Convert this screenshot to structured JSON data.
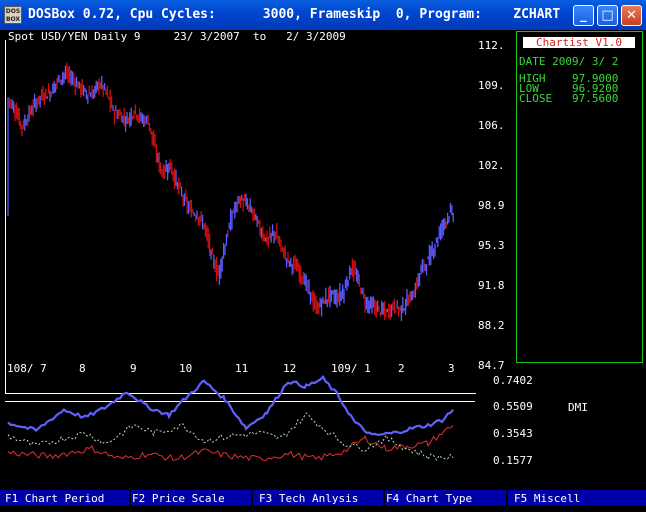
{
  "window": {
    "icon_text": "DOS BOX",
    "title": "DOSBox 0.72, Cpu Cycles:      3000, Frameskip  0, Program:    ZCHART",
    "buttons": {
      "minimize": "_",
      "maximize": "□",
      "close": "✕"
    }
  },
  "chart": {
    "header": "Spot USD/YEN Daily 9     23/ 3/2007  to   2/ 3/2009",
    "y_ticks": [
      "112.",
      "109.",
      "106.",
      "102.",
      "98.9",
      "95.3",
      "91.8",
      "88.2",
      "84.7"
    ],
    "x_ticks": [
      "108/ 7",
      "8",
      "9",
      "10",
      "11",
      "12",
      "109/ 1",
      "2",
      "3"
    ],
    "indicator_ticks": [
      "0.7402",
      "0.5509",
      "0.3543",
      "0.1577"
    ],
    "indicator_name": "DMI"
  },
  "chart_data": {
    "type": "bar",
    "subtype": "ohlc",
    "title": "Spot USD/YEN Daily 9",
    "date_range": "23/ 3/2007 to 2/ 3/2009",
    "x": [
      "2008-07",
      "2008-08",
      "2008-09",
      "2008-10",
      "2008-11",
      "2008-12",
      "2009-01",
      "2009-02",
      "2009-03"
    ],
    "ylim": [
      84.7,
      112.0
    ],
    "price_approx": [
      [
        0,
        107.5
      ],
      [
        5,
        106.5
      ],
      [
        10,
        105.0
      ],
      [
        15,
        106.2
      ],
      [
        20,
        107.2
      ],
      [
        25,
        107.8
      ],
      [
        30,
        108.0
      ],
      [
        35,
        109.0
      ],
      [
        40,
        109.6
      ],
      [
        45,
        109.3
      ],
      [
        50,
        108.6
      ],
      [
        55,
        108.0
      ],
      [
        60,
        107.8
      ],
      [
        65,
        108.8
      ],
      [
        70,
        108.0
      ],
      [
        75,
        106.4
      ],
      [
        80,
        106.0
      ],
      [
        85,
        105.6
      ],
      [
        90,
        106.5
      ],
      [
        95,
        105.7
      ],
      [
        100,
        105.6
      ],
      [
        105,
        103.0
      ],
      [
        110,
        101.0
      ],
      [
        115,
        101.8
      ],
      [
        120,
        100.3
      ],
      [
        125,
        98.9
      ],
      [
        130,
        97.8
      ],
      [
        135,
        97.5
      ],
      [
        140,
        96.5
      ],
      [
        145,
        94.0
      ],
      [
        150,
        92.3
      ],
      [
        155,
        95.0
      ],
      [
        160,
        97.5
      ],
      [
        165,
        98.8
      ],
      [
        170,
        98.4
      ],
      [
        175,
        97.6
      ],
      [
        180,
        96.2
      ],
      [
        185,
        95.2
      ],
      [
        190,
        96.0
      ],
      [
        195,
        94.6
      ],
      [
        200,
        93.5
      ],
      [
        205,
        93.0
      ],
      [
        210,
        92.2
      ],
      [
        215,
        90.8
      ],
      [
        220,
        89.3
      ],
      [
        225,
        90.0
      ],
      [
        230,
        90.6
      ],
      [
        235,
        90.3
      ],
      [
        240,
        91.0
      ],
      [
        245,
        93.0
      ],
      [
        250,
        91.8
      ],
      [
        255,
        90.0
      ],
      [
        260,
        89.6
      ],
      [
        265,
        89.3
      ],
      [
        270,
        89.0
      ],
      [
        275,
        89.6
      ],
      [
        280,
        89.3
      ],
      [
        285,
        90.0
      ],
      [
        290,
        90.8
      ],
      [
        295,
        92.8
      ],
      [
        300,
        93.5
      ],
      [
        305,
        95.0
      ],
      [
        310,
        96.5
      ],
      [
        315,
        97.6
      ],
      [
        318,
        97.5
      ]
    ],
    "last_bar": {
      "date": "2009/ 3/ 2",
      "high": 97.9,
      "low": 96.92,
      "close": 97.56
    },
    "indicator": {
      "name": "DMI",
      "ylim": [
        0.0,
        0.7402
      ],
      "series": [
        {
          "color": "#6060ff",
          "values": [
            [
              0,
              0.38
            ],
            [
              20,
              0.32
            ],
            [
              40,
              0.48
            ],
            [
              55,
              0.42
            ],
            [
              70,
              0.5
            ],
            [
              85,
              0.62
            ],
            [
              100,
              0.5
            ],
            [
              115,
              0.44
            ],
            [
              125,
              0.55
            ],
            [
              140,
              0.7
            ],
            [
              155,
              0.56
            ],
            [
              170,
              0.34
            ],
            [
              185,
              0.46
            ],
            [
              200,
              0.7
            ],
            [
              213,
              0.66
            ],
            [
              225,
              0.72
            ],
            [
              235,
              0.6
            ],
            [
              248,
              0.38
            ],
            [
              260,
              0.28
            ],
            [
              275,
              0.3
            ],
            [
              290,
              0.34
            ],
            [
              300,
              0.36
            ],
            [
              310,
              0.4
            ],
            [
              318,
              0.48
            ]
          ]
        },
        {
          "color": "#e03030",
          "values": [
            [
              0,
              0.15
            ],
            [
              30,
              0.12
            ],
            [
              60,
              0.18
            ],
            [
              80,
              0.1
            ],
            [
              100,
              0.14
            ],
            [
              120,
              0.1
            ],
            [
              140,
              0.16
            ],
            [
              160,
              0.12
            ],
            [
              180,
              0.1
            ],
            [
              200,
              0.14
            ],
            [
              220,
              0.1
            ],
            [
              240,
              0.16
            ],
            [
              255,
              0.26
            ],
            [
              270,
              0.18
            ],
            [
              285,
              0.2
            ],
            [
              300,
              0.22
            ],
            [
              310,
              0.3
            ],
            [
              318,
              0.36
            ]
          ]
        },
        {
          "color": "#b0e0b0",
          "values": [
            [
              0,
              0.28
            ],
            [
              20,
              0.2
            ],
            [
              40,
              0.26
            ],
            [
              55,
              0.3
            ],
            [
              70,
              0.22
            ],
            [
              90,
              0.36
            ],
            [
              105,
              0.3
            ],
            [
              125,
              0.36
            ],
            [
              140,
              0.24
            ],
            [
              160,
              0.28
            ],
            [
              180,
              0.3
            ],
            [
              195,
              0.26
            ],
            [
              213,
              0.44
            ],
            [
              225,
              0.34
            ],
            [
              240,
              0.22
            ],
            [
              255,
              0.18
            ],
            [
              270,
              0.26
            ],
            [
              285,
              0.18
            ],
            [
              300,
              0.12
            ],
            [
              318,
              0.11
            ]
          ]
        }
      ]
    }
  },
  "panel": {
    "title": "Chartist V1.0",
    "date_label": "DATE",
    "date": "2009/ 3/ 2",
    "high_label": "HIGH",
    "high": "97.9000",
    "low_label": "LOW",
    "low": "96.9200",
    "close_label": "CLOSE",
    "close": "97.5600"
  },
  "menu": {
    "items": [
      "F1 Chart Period",
      "F2 Price Scale",
      "F3 Tech Anlysis",
      "F4 Chart Type",
      "F5 Miscell"
    ]
  },
  "colors": {
    "up": "#5a5aff",
    "down": "#cc1010",
    "panel_border": "#19c419",
    "menu_bg": "#0000a8",
    "titlebar": "#0046d0"
  }
}
